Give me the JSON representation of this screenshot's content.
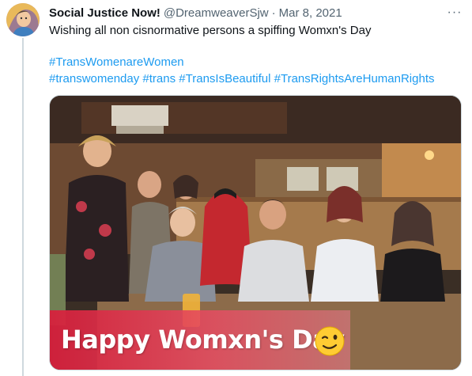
{
  "tweet": {
    "author": {
      "display_name": "Social Justice Now!",
      "handle": "@DreamweaverSjw",
      "avatar_icon": "profile-avatar"
    },
    "separator": "·",
    "date": "Mar 8, 2021",
    "more_icon": "more-options-icon",
    "more_label": "···",
    "text": "Wishing all non cisnormative persons a spiffing Womxn's Day",
    "hashtags_line1": [
      "#TransWomenareWomen"
    ],
    "hashtags_line2": [
      "#transwomenday",
      "#trans",
      "#TransIsBeautiful",
      "#TransRightsAreHumanRights"
    ],
    "link_color": "#1d9bf0",
    "media": {
      "description_icon": "tweet-photo",
      "banner_text": "Happy Womxn's Day",
      "banner_color": "#d6203c",
      "emoji": "winking-face-icon"
    }
  }
}
